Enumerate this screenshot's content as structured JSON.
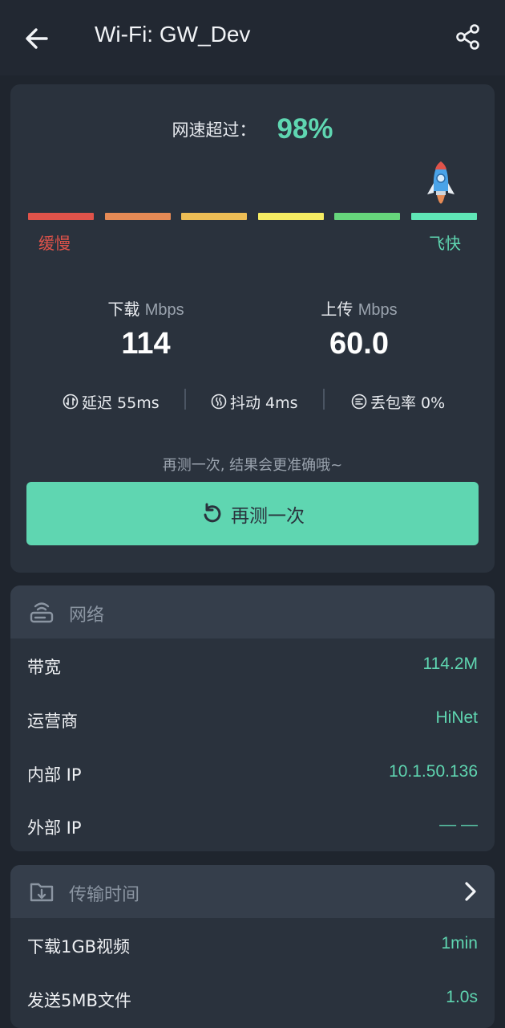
{
  "header": {
    "title": "Wi-Fi: GW_Dev",
    "back_icon": "arrow-left-icon",
    "share_icon": "share-icon"
  },
  "result": {
    "exceed_label": "网速超过：",
    "exceed_value": "98%",
    "meter": {
      "slow_label": "缓慢",
      "fast_label": "飞快",
      "segments": [
        "#e0534a",
        "#e58a55",
        "#edbd55",
        "#f6ec63",
        "#66d67c",
        "#5fe6b6"
      ],
      "level_percent": 98
    },
    "download": {
      "label": "下载",
      "unit": "Mbps",
      "value": "114"
    },
    "upload": {
      "label": "上传",
      "unit": "Mbps",
      "value": "60.0"
    },
    "stats": [
      {
        "icon": "latency-icon",
        "text": "延迟 55ms"
      },
      {
        "icon": "jitter-icon",
        "text": "抖动 4ms"
      },
      {
        "icon": "packet-loss-icon",
        "text": "丢包率 0%"
      }
    ],
    "retest_hint": "再测一次, 结果会更准确哦~",
    "retest_button": "再测一次"
  },
  "network": {
    "title": "网络",
    "icon": "router-icon",
    "rows": [
      {
        "key": "带宽",
        "value": "114.2M"
      },
      {
        "key": "运营商",
        "value": "HiNet"
      },
      {
        "key": "内部 IP",
        "value": "10.1.50.136"
      },
      {
        "key": "外部 IP",
        "value": "— —"
      }
    ]
  },
  "transfer": {
    "title": "传输时间",
    "icon": "download-folder-icon",
    "rows": [
      {
        "key": "下载1GB视频",
        "value": "1min"
      },
      {
        "key": "发送5MB文件",
        "value": "1.0s"
      }
    ]
  },
  "colors": {
    "accent": "#5fd6b1",
    "background": "#1f252e",
    "card": "#2a323d",
    "card_header": "#353e4b"
  }
}
